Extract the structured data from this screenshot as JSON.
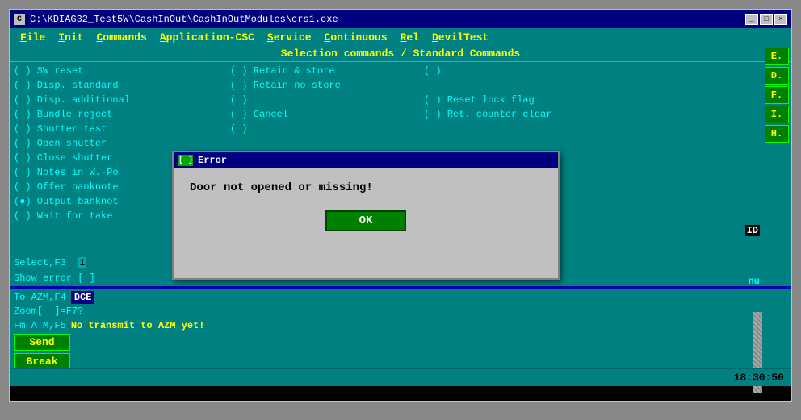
{
  "window": {
    "title": "C:\\KDIAG32_Test5W\\CashInOut\\CashInOutModules\\crs1.exe",
    "icon": "C"
  },
  "titleButtons": [
    "_",
    "□",
    "×"
  ],
  "menuBar": {
    "items": [
      {
        "label": "File",
        "underline": "F"
      },
      {
        "label": "Init",
        "underline": "I"
      },
      {
        "label": "Commands",
        "underline": "C"
      },
      {
        "label": "Application-CSC",
        "underline": "A"
      },
      {
        "label": "Service",
        "underline": "S"
      },
      {
        "label": "Continuous",
        "underline": "C"
      },
      {
        "label": "Rel",
        "underline": "R"
      },
      {
        "label": "DevilTest",
        "underline": "D"
      }
    ]
  },
  "sectionHeader": "Selection commands / Standard Commands",
  "leftColumn": {
    "items": [
      "( )  SW reset",
      "( )  Disp. standard",
      "( )  Disp. additional",
      "( )  Bundle reject",
      "( )  Shutter test",
      "( )  Open shutter",
      "( )  Close shutter",
      "( )  Notes in W.-Po",
      "( )  Offer banknote",
      "(●)  Output banknot",
      "( )  Wait for take"
    ]
  },
  "middleColumn": {
    "items": [
      "( )  Retain & store",
      "( )  Retain no store",
      "( )",
      "( )  Cancel",
      "( )",
      "",
      "",
      "",
      "",
      "",
      ""
    ]
  },
  "rightColumn": {
    "items": [
      "( )",
      "",
      "( )  Reset lock flag",
      "( )  Ret. counter clear",
      "",
      "",
      "",
      "",
      "",
      "",
      ""
    ]
  },
  "statusLines": {
    "select": "Select,F3",
    "selectHighlight": "1",
    "showError": "Show error",
    "showErrorBracket": "[ ]"
  },
  "bottomSection": {
    "toAzm": "To AZM,F4",
    "dceBadge": "DCE",
    "zoom": "Zoom[  ]=F7?",
    "fmAzm": "Fm A M,F5",
    "noTransmit": "No transmit to AZM yet!",
    "sendBtn": "Send",
    "breakBtn": "Break"
  },
  "sideButtons": [
    "E.",
    "D.",
    "F.",
    "I.",
    "H."
  ],
  "dialog": {
    "title": "Error",
    "indicator": "[ ]",
    "message": "Door not opened or missing!",
    "okBtn": "OK"
  },
  "idLabel": "ID",
  "nuLabel": "nu",
  "timestamp": "18:30:50"
}
